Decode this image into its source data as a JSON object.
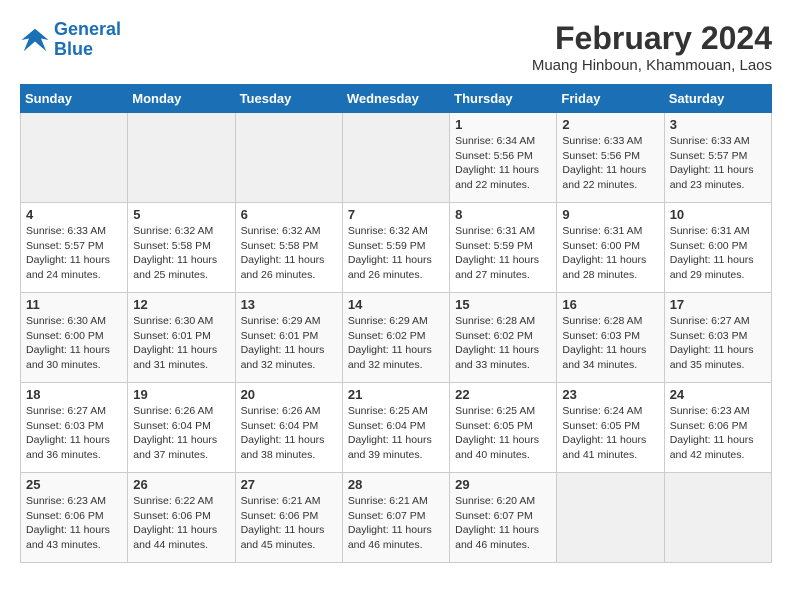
{
  "logo": {
    "line1": "General",
    "line2": "Blue"
  },
  "title": "February 2024",
  "subtitle": "Muang Hinboun, Khammouan, Laos",
  "days_of_week": [
    "Sunday",
    "Monday",
    "Tuesday",
    "Wednesday",
    "Thursday",
    "Friday",
    "Saturday"
  ],
  "weeks": [
    [
      {
        "day": "",
        "info": ""
      },
      {
        "day": "",
        "info": ""
      },
      {
        "day": "",
        "info": ""
      },
      {
        "day": "",
        "info": ""
      },
      {
        "day": "1",
        "info": "Sunrise: 6:34 AM\nSunset: 5:56 PM\nDaylight: 11 hours\nand 22 minutes."
      },
      {
        "day": "2",
        "info": "Sunrise: 6:33 AM\nSunset: 5:56 PM\nDaylight: 11 hours\nand 22 minutes."
      },
      {
        "day": "3",
        "info": "Sunrise: 6:33 AM\nSunset: 5:57 PM\nDaylight: 11 hours\nand 23 minutes."
      }
    ],
    [
      {
        "day": "4",
        "info": "Sunrise: 6:33 AM\nSunset: 5:57 PM\nDaylight: 11 hours\nand 24 minutes."
      },
      {
        "day": "5",
        "info": "Sunrise: 6:32 AM\nSunset: 5:58 PM\nDaylight: 11 hours\nand 25 minutes."
      },
      {
        "day": "6",
        "info": "Sunrise: 6:32 AM\nSunset: 5:58 PM\nDaylight: 11 hours\nand 26 minutes."
      },
      {
        "day": "7",
        "info": "Sunrise: 6:32 AM\nSunset: 5:59 PM\nDaylight: 11 hours\nand 26 minutes."
      },
      {
        "day": "8",
        "info": "Sunrise: 6:31 AM\nSunset: 5:59 PM\nDaylight: 11 hours\nand 27 minutes."
      },
      {
        "day": "9",
        "info": "Sunrise: 6:31 AM\nSunset: 6:00 PM\nDaylight: 11 hours\nand 28 minutes."
      },
      {
        "day": "10",
        "info": "Sunrise: 6:31 AM\nSunset: 6:00 PM\nDaylight: 11 hours\nand 29 minutes."
      }
    ],
    [
      {
        "day": "11",
        "info": "Sunrise: 6:30 AM\nSunset: 6:00 PM\nDaylight: 11 hours\nand 30 minutes."
      },
      {
        "day": "12",
        "info": "Sunrise: 6:30 AM\nSunset: 6:01 PM\nDaylight: 11 hours\nand 31 minutes."
      },
      {
        "day": "13",
        "info": "Sunrise: 6:29 AM\nSunset: 6:01 PM\nDaylight: 11 hours\nand 32 minutes."
      },
      {
        "day": "14",
        "info": "Sunrise: 6:29 AM\nSunset: 6:02 PM\nDaylight: 11 hours\nand 32 minutes."
      },
      {
        "day": "15",
        "info": "Sunrise: 6:28 AM\nSunset: 6:02 PM\nDaylight: 11 hours\nand 33 minutes."
      },
      {
        "day": "16",
        "info": "Sunrise: 6:28 AM\nSunset: 6:03 PM\nDaylight: 11 hours\nand 34 minutes."
      },
      {
        "day": "17",
        "info": "Sunrise: 6:27 AM\nSunset: 6:03 PM\nDaylight: 11 hours\nand 35 minutes."
      }
    ],
    [
      {
        "day": "18",
        "info": "Sunrise: 6:27 AM\nSunset: 6:03 PM\nDaylight: 11 hours\nand 36 minutes."
      },
      {
        "day": "19",
        "info": "Sunrise: 6:26 AM\nSunset: 6:04 PM\nDaylight: 11 hours\nand 37 minutes."
      },
      {
        "day": "20",
        "info": "Sunrise: 6:26 AM\nSunset: 6:04 PM\nDaylight: 11 hours\nand 38 minutes."
      },
      {
        "day": "21",
        "info": "Sunrise: 6:25 AM\nSunset: 6:04 PM\nDaylight: 11 hours\nand 39 minutes."
      },
      {
        "day": "22",
        "info": "Sunrise: 6:25 AM\nSunset: 6:05 PM\nDaylight: 11 hours\nand 40 minutes."
      },
      {
        "day": "23",
        "info": "Sunrise: 6:24 AM\nSunset: 6:05 PM\nDaylight: 11 hours\nand 41 minutes."
      },
      {
        "day": "24",
        "info": "Sunrise: 6:23 AM\nSunset: 6:06 PM\nDaylight: 11 hours\nand 42 minutes."
      }
    ],
    [
      {
        "day": "25",
        "info": "Sunrise: 6:23 AM\nSunset: 6:06 PM\nDaylight: 11 hours\nand 43 minutes."
      },
      {
        "day": "26",
        "info": "Sunrise: 6:22 AM\nSunset: 6:06 PM\nDaylight: 11 hours\nand 44 minutes."
      },
      {
        "day": "27",
        "info": "Sunrise: 6:21 AM\nSunset: 6:06 PM\nDaylight: 11 hours\nand 45 minutes."
      },
      {
        "day": "28",
        "info": "Sunrise: 6:21 AM\nSunset: 6:07 PM\nDaylight: 11 hours\nand 46 minutes."
      },
      {
        "day": "29",
        "info": "Sunrise: 6:20 AM\nSunset: 6:07 PM\nDaylight: 11 hours\nand 46 minutes."
      },
      {
        "day": "",
        "info": ""
      },
      {
        "day": "",
        "info": ""
      }
    ]
  ]
}
